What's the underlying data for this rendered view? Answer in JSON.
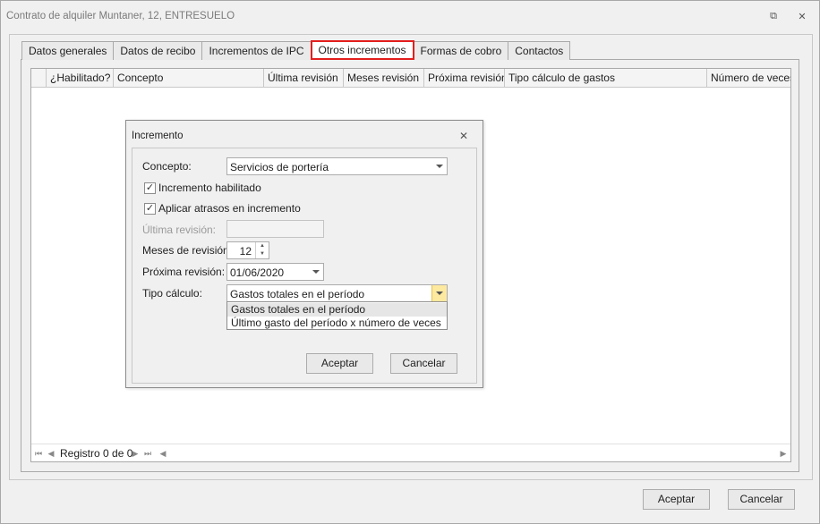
{
  "window": {
    "title": "Contrato de alquiler Muntaner, 12, ENTRESUELO",
    "restore_glyph": "⧉",
    "close_glyph": "✕"
  },
  "tabs": [
    {
      "label": "Datos generales"
    },
    {
      "label": "Datos de recibo"
    },
    {
      "label": "Incrementos de IPC"
    },
    {
      "label": "Otros incrementos",
      "active": true
    },
    {
      "label": "Formas de cobro"
    },
    {
      "label": "Contactos"
    }
  ],
  "grid": {
    "columns": [
      "¿Habilitado?",
      "Concepto",
      "Última revisión",
      "Meses revisión",
      "Próxima revisión",
      "Tipo cálculo de gastos",
      "Número de veces"
    ],
    "navigator": {
      "first": "⏮",
      "prev": "◀",
      "record_text": "Registro 0 de 0",
      "next": "▶",
      "last": "⏭",
      "prev_page": "◀",
      "scroll_right": "▶"
    }
  },
  "dialog": {
    "title": "Incremento",
    "close_glyph": "✕",
    "concepto_label": "Concepto:",
    "concepto_value": "Servicios de portería",
    "check_habilitado_label": "Incremento habilitado",
    "check_habilitado": true,
    "check_atrasos_label": "Aplicar atrasos en incremento",
    "check_atrasos": true,
    "ultima_revision_label": "Última revisión:",
    "ultima_revision_value": "",
    "meses_revision_label": "Meses de revisión:",
    "meses_revision_value": "12",
    "proxima_revision_label": "Próxima revisión:",
    "proxima_revision_value": "01/06/2020",
    "tipo_calculo_label": "Tipo cálculo:",
    "tipo_calculo_value": "Gastos totales en el período",
    "tipo_calculo_options": [
      "Gastos totales en el período",
      "Último gasto del período x número de veces"
    ],
    "accept_label": "Aceptar",
    "cancel_label": "Cancelar",
    "check_glyph": "✓",
    "spin_up": "▲",
    "spin_down": "▼"
  },
  "footer": {
    "accept_label": "Aceptar",
    "cancel_label": "Cancelar"
  },
  "colors": {
    "active_tab_border": "#e31d1d",
    "dropdown_hot": "#fde9a0"
  }
}
